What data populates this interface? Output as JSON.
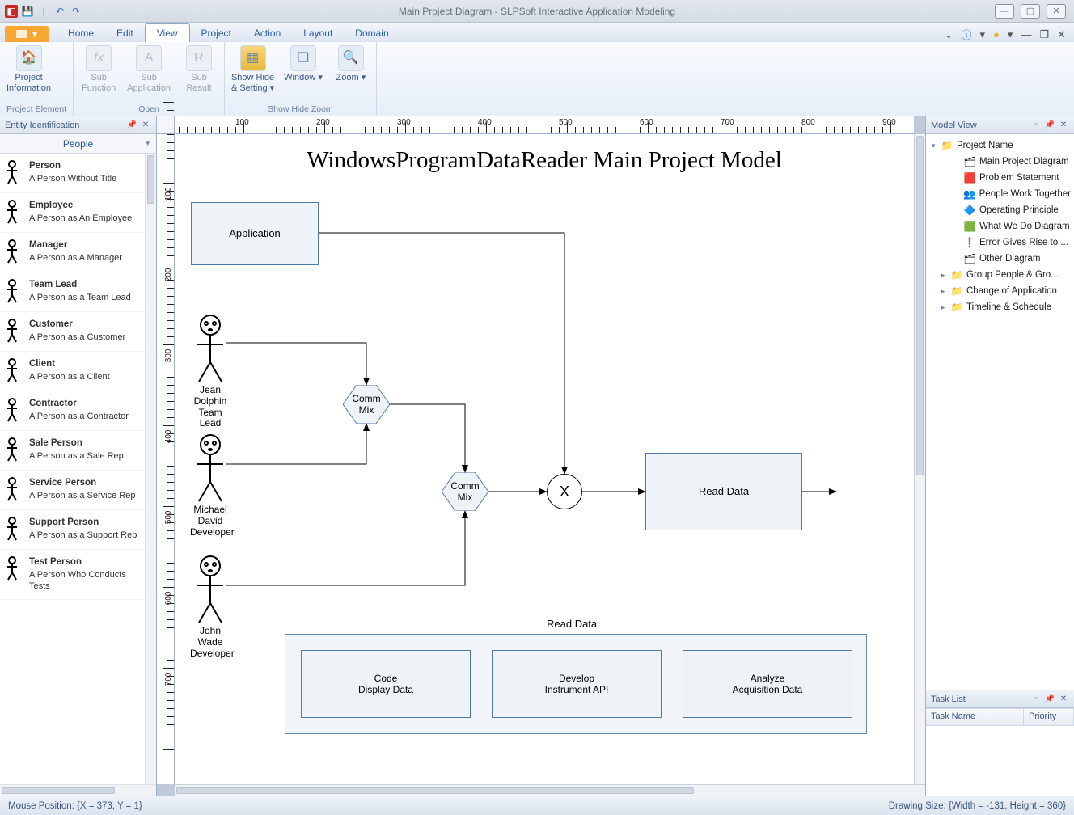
{
  "window_title": "Main Project Diagram - SLPSoft Interactive Application Modeling",
  "tabs": {
    "file": "",
    "home": "Home",
    "edit": "Edit",
    "view": "View",
    "project": "Project",
    "action": "Action",
    "layout": "Layout",
    "domain": "Domain"
  },
  "ribbon": {
    "project_element": {
      "label": "Project Element",
      "project_info": "Project\nInformation"
    },
    "open": {
      "label": "Open",
      "sub_function": "Sub\nFunction",
      "sub_application": "Sub\nApplication",
      "sub_result": "Sub\nResult"
    },
    "showhide": {
      "label": "Show Hide Zoom",
      "showhide": "Show Hide\n& Setting",
      "window": "Window",
      "zoom": "Zoom"
    }
  },
  "left_panel": {
    "title": "Entity Identification",
    "dropdown": "People",
    "entities": [
      {
        "name": "Person",
        "desc": "A Person Without Title"
      },
      {
        "name": "Employee",
        "desc": "A Person as An Employee"
      },
      {
        "name": "Manager",
        "desc": "A Person as A Manager"
      },
      {
        "name": "Team Lead",
        "desc": "A Person as a Team Lead"
      },
      {
        "name": "Customer",
        "desc": "A Person as a Customer"
      },
      {
        "name": "Client",
        "desc": "A Person as a Client"
      },
      {
        "name": "Contractor",
        "desc": "A Person as a Contractor"
      },
      {
        "name": "Sale Person",
        "desc": "A Person as a Sale Rep"
      },
      {
        "name": "Service Person",
        "desc": "A Person as a Service Rep"
      },
      {
        "name": "Support Person",
        "desc": "A Person as a Support Rep"
      },
      {
        "name": "Test Person",
        "desc": "A Person Who Conducts Tests"
      }
    ]
  },
  "diagram": {
    "title": "WindowsProgramDataReader Main Project Model",
    "application": "Application",
    "comm_mix": "Comm\nMix",
    "x": "X",
    "read_data": "Read Data",
    "people": [
      {
        "name": "Jean Dolphin",
        "role": "Team Lead"
      },
      {
        "name": "Michael David",
        "role": "Developer"
      },
      {
        "name": "John Wade",
        "role": "Developer"
      }
    ],
    "container_label": "Read Data",
    "sub_boxes": [
      "Code\nDisplay Data",
      "Develop\nInstrument API",
      "Analyze\nAcquisition Data"
    ]
  },
  "model_view": {
    "title": "Model View",
    "root": "Project Name",
    "children": [
      "Main Project Diagram",
      "Problem Statement",
      "People Work Together",
      "Operating Principle",
      "What We Do Diagram",
      "Error Gives Rise to ...",
      "Other Diagram"
    ],
    "groups": [
      "Group People & Gro...",
      "Change of Application",
      "Timeline & Schedule"
    ]
  },
  "task_list": {
    "title": "Task List",
    "cols": [
      "Task Name",
      "Priority"
    ]
  },
  "status": {
    "mouse": "Mouse Position: {X = 373,  Y = 1}",
    "size": "Drawing Size: {Width = -131, Height = 360}"
  },
  "ruler_ticks": [
    100,
    200,
    300,
    400,
    500,
    600,
    700,
    800,
    900
  ],
  "vruler_ticks": [
    100,
    200,
    300,
    400,
    500,
    600,
    700
  ]
}
